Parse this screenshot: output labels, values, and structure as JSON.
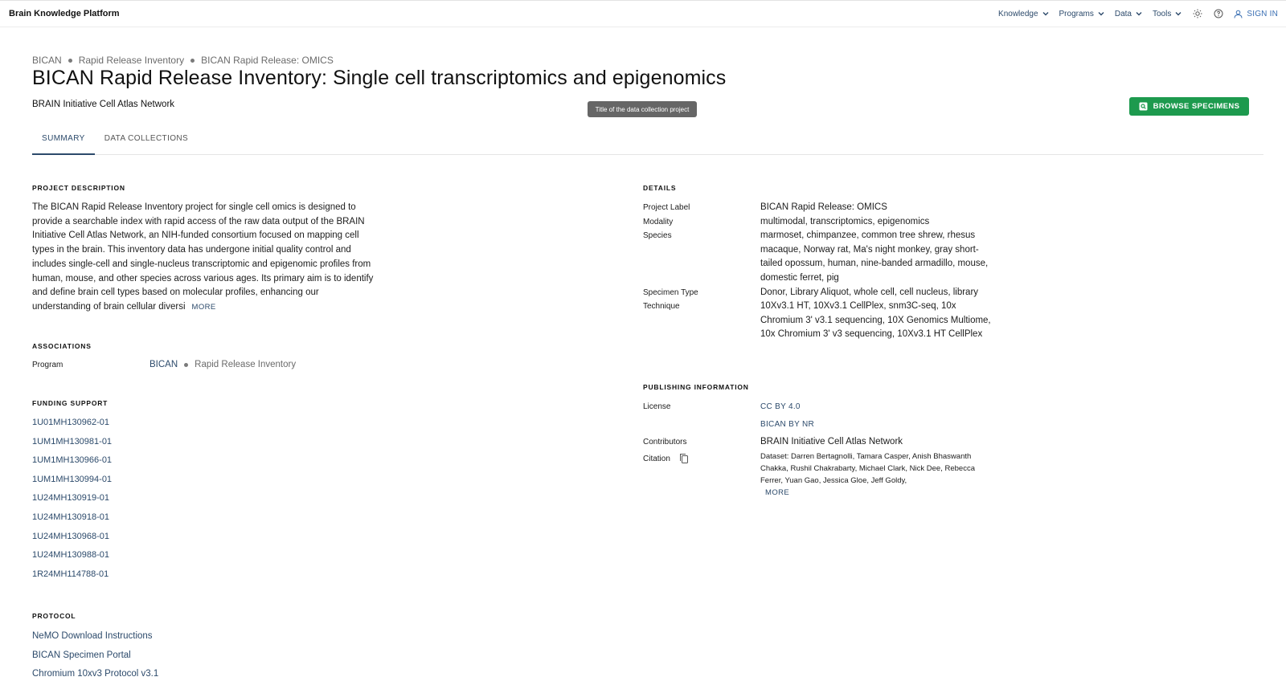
{
  "header": {
    "brand": "Brain Knowledge Platform",
    "nav": [
      {
        "label": "Knowledge"
      },
      {
        "label": "Programs"
      },
      {
        "label": "Data"
      },
      {
        "label": "Tools"
      }
    ],
    "icons": [
      "sun-icon",
      "help-circle-icon",
      "user-icon"
    ],
    "signin_label": "SIGN IN"
  },
  "breadcrumb": [
    "BICAN",
    "Rapid Release Inventory",
    "BICAN Rapid Release: OMICS"
  ],
  "page": {
    "title": "BICAN Rapid Release Inventory: Single cell transcriptomics and epigenomics",
    "subtitle": "BRAIN Initiative Cell Atlas Network",
    "tooltip": "Title of the data collection project",
    "browse_button": "BROWSE SPECIMENS"
  },
  "tabs": [
    {
      "label": "SUMMARY",
      "active": true
    },
    {
      "label": "DATA COLLECTIONS",
      "active": false
    }
  ],
  "project_description": {
    "heading": "PROJECT DESCRIPTION",
    "text": "The BICAN Rapid Release Inventory project for single cell omics is designed to provide a searchable index with rapid access of the raw data output of the BRAIN Initiative Cell Atlas Network, an NIH-funded consortium focused on mapping cell types in the brain. This inventory data has undergone initial quality control and includes single-cell and single-nucleus transcriptomic and epigenomic profiles from human, mouse, and other species across various ages. Its primary aim is to identify and define brain cell types based on molecular profiles, enhancing our understanding of brain cellular diversi",
    "more": "MORE"
  },
  "associations": {
    "heading": "ASSOCIATIONS",
    "program_label": "Program",
    "program": "BICAN",
    "sub_program": "Rapid Release Inventory"
  },
  "funding": {
    "heading": "FUNDING SUPPORT",
    "items": [
      "1U01MH130962-01",
      "1UM1MH130981-01",
      "1UM1MH130966-01",
      "1UM1MH130994-01",
      "1U24MH130919-01",
      "1U24MH130918-01",
      "1U24MH130968-01",
      "1U24MH130988-01",
      "1R24MH114788-01"
    ]
  },
  "protocol": {
    "heading": "PROTOCOL",
    "items": [
      "NeMO Download Instructions",
      "BICAN Specimen Portal",
      "Chromium 10xv3 Protocol v3.1"
    ]
  },
  "details": {
    "heading": "DETAILS",
    "project_label_key": "Project Label",
    "project_label": "BICAN Rapid Release: OMICS",
    "modality_key": "Modality",
    "modality": "multimodal, transcriptomics, epigenomics",
    "species_key": "Species",
    "species": "marmoset, chimpanzee, common tree shrew, rhesus macaque, Norway rat, Ma's night monkey, gray short-tailed opossum, human, nine-banded armadillo, mouse, domestic ferret, pig",
    "specimen_type_key": "Specimen Type",
    "specimen_type": "Donor, Library Aliquot, whole cell, cell nucleus, library",
    "technique_key": "Technique",
    "technique": "10Xv3.1 HT, 10Xv3.1 CellPlex, snm3C-seq, 10x Chromium 3' v3.1 sequencing, 10X Genomics Multiome, 10x Chromium 3' v3 sequencing, 10Xv3.1 HT CellPlex"
  },
  "publishing": {
    "heading": "PUBLISHING INFORMATION",
    "license_key": "License",
    "license_1": "CC BY 4.0",
    "license_2": "BICAN BY NR",
    "contributors_key": "Contributors",
    "contributors": "BRAIN Initiative Cell Atlas Network",
    "citation_key": "Citation",
    "citation": "Dataset: Darren Bertagnolli, Tamara Casper, Anish Bhaswanth Chakka, Rushil Chakrabarty, Michael Clark, Nick Dee, Rebecca Ferrer, Yuan Gao, Jessica Gloe, Jeff Goldy,",
    "more": "MORE"
  },
  "colors": {
    "link": "#2c4a6b",
    "accent_green": "#1d9a4e",
    "signin_blue": "#3a6fb3"
  }
}
